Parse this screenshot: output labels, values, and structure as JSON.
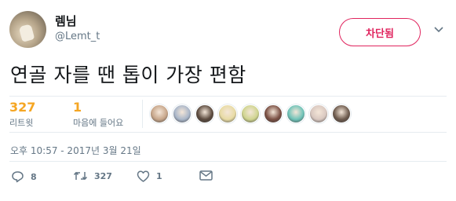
{
  "user": {
    "display_name": "렘님",
    "handle": "@Lemt_t"
  },
  "block_button": {
    "label": "차단됨"
  },
  "tweet": {
    "text": "연골 자를 땐 톱이 가장 편함"
  },
  "stats": {
    "retweets": {
      "count": "327",
      "label": "리트윗"
    },
    "likes": {
      "count": "1",
      "label": "마음에 들어요"
    }
  },
  "likers": [
    {
      "color": "#c7a68a"
    },
    {
      "color": "#a9b6c9"
    },
    {
      "color": "#5b4a3e"
    },
    {
      "color": "#e8dba4"
    },
    {
      "color": "#cfd48f"
    },
    {
      "color": "#7a4f43"
    },
    {
      "color": "#6fc3b8"
    },
    {
      "color": "#d9c8c0"
    },
    {
      "color": "#6d5a4d"
    }
  ],
  "timestamp": "오후 10:57 - 2017년 3월 21일",
  "actions": {
    "reply_count": "8",
    "retweet_count": "327",
    "like_count": "1"
  },
  "colors": {
    "accent_block": "#e0245e",
    "stat_number": "#f5a623",
    "secondary_text": "#657786"
  }
}
